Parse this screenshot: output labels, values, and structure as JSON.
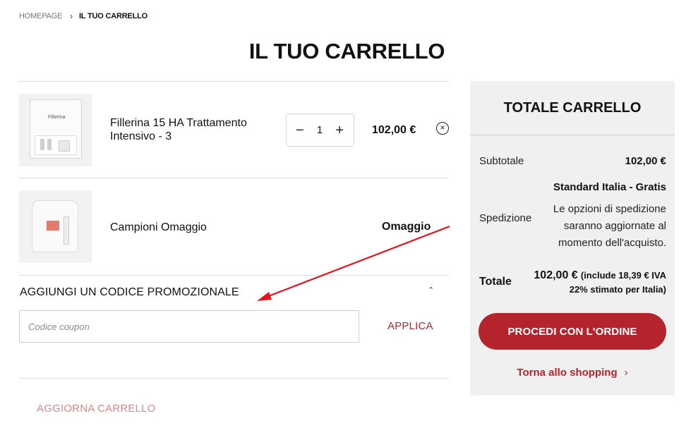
{
  "breadcrumb": {
    "home": "HOMEPAGE",
    "separator": "›",
    "current": "IL TUO CARRELLO"
  },
  "page_title": "IL TUO CARRELLO",
  "cart": {
    "items": [
      {
        "name": "Fillerina 15 HA Trattamento Intensivo - 3",
        "quantity": "1",
        "price": "102,00 €",
        "thumb_logo": "Fillerina"
      },
      {
        "name": "Campioni Omaggio",
        "price": "Omaggio"
      }
    ],
    "qty_decrease": "−",
    "qty_increase": "+",
    "remove_icon": "×"
  },
  "promo": {
    "title": "AGGIUNGI UN CODICE PROMOZIONALE",
    "toggle_icon": "⌃",
    "placeholder": "Codice coupon",
    "apply_label": "APPLICA"
  },
  "update_cart_label": "AGGIORNA CARRELLO",
  "summary": {
    "title": "TOTALE CARRELLO",
    "subtotal_label": "Subtotale",
    "subtotal_value": "102,00 €",
    "shipping_label": "Spedizione",
    "shipping_method": "Standard Italia - Gratis",
    "shipping_note": "Le opzioni di spedizione saranno aggiornate al momento dell'acquisto.",
    "total_label": "Totale",
    "total_amount": "102,00 €",
    "total_note": "(include 18,39 € IVA 22% stimato per Italia)",
    "checkout_label": "PROCEDI CON L'ORDINE",
    "back_label": "Torna allo shopping",
    "back_chevron": "›"
  },
  "colors": {
    "accent": "#b5242c",
    "panel": "#f0f0f0",
    "annotation_arrow": "#e5141e"
  }
}
